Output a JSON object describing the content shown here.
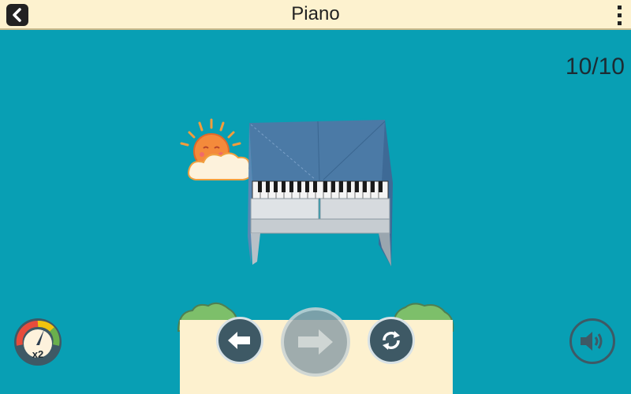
{
  "header": {
    "title": "Piano"
  },
  "progress": {
    "text": "10/10"
  },
  "speed": {
    "label": "x2"
  },
  "icons": {
    "back": "chevron-left-icon",
    "menu": "vertical-dots-icon",
    "prev": "arrow-left-icon",
    "next": "arrow-right-icon",
    "replay": "refresh-icon",
    "sound": "speaker-icon",
    "speed": "speedometer-icon"
  },
  "colors": {
    "background": "#089fb4",
    "header": "#fdf2cf",
    "button_dark": "#3e5965",
    "button_disabled": "#8fa1a8",
    "piano_blue": "#4b7aa6",
    "sun": "#f39c3c"
  }
}
